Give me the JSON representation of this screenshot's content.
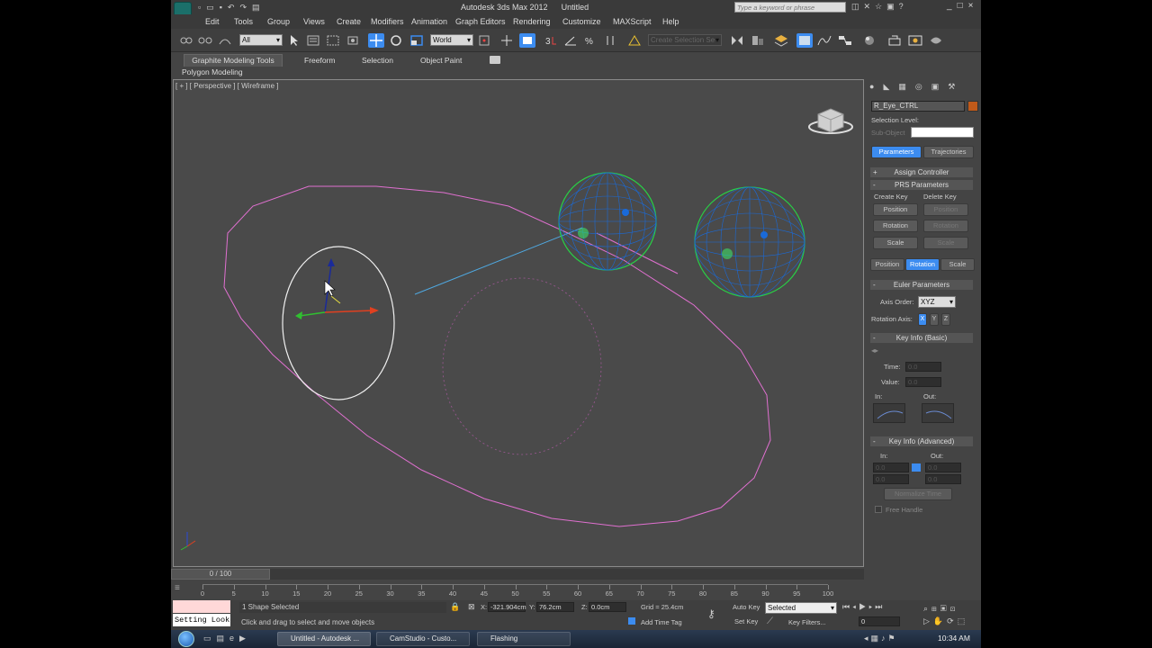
{
  "window": {
    "title_app": "Autodesk 3ds Max 2012",
    "title_file": "Untitled",
    "search_placeholder": "Type a keyword or phrase"
  },
  "menu": [
    "Edit",
    "Tools",
    "Group",
    "Views",
    "Create",
    "Modifiers",
    "Animation",
    "Graph Editors",
    "Rendering",
    "Customize",
    "MAXScript",
    "Help"
  ],
  "toolbar": {
    "selection_filter": "All",
    "ref_coord": "World",
    "named_selection_placeholder": "Create Selection Se"
  },
  "ribbon": {
    "tabs": [
      "Graphite Modeling Tools",
      "Freeform",
      "Selection",
      "Object Paint"
    ],
    "subtab": "Polygon Modeling"
  },
  "viewport": {
    "label": "[ + ] [ Perspective ] [ Wireframe ]"
  },
  "command_panel": {
    "object_name": "R_Eye_CTRL",
    "selection_level_label": "Selection Level:",
    "sub_object_label": "Sub-Object",
    "tabs": [
      "Parameters",
      "Trajectories"
    ],
    "assign_controller": "Assign Controller",
    "prs_header": "PRS Parameters",
    "create_key": "Create Key",
    "delete_key": "Delete Key",
    "create_buttons": [
      "Position",
      "Rotation",
      "Scale"
    ],
    "delete_buttons": [
      "Position",
      "Rotation",
      "Scale"
    ],
    "mode_buttons": [
      "Position",
      "Rotation",
      "Scale"
    ],
    "euler_header": "Euler Parameters",
    "axis_order_label": "Axis Order:",
    "axis_order_value": "XYZ",
    "rotation_axis_label": "Rotation Axis:",
    "rotation_axes": [
      "X",
      "Y",
      "Z"
    ],
    "key_info_basic": "Key Info (Basic)",
    "time_label": "Time:",
    "value_label": "Value:",
    "in_label": "In:",
    "out_label": "Out:",
    "key_info_adv": "Key Info (Advanced)",
    "in_label2": "In:",
    "out_label2": "Out:",
    "normalize_time": "Normalize Time",
    "free_handle": "Free Handle",
    "blank_value": "0.0"
  },
  "timeline": {
    "frame_display": "0 / 100",
    "ticks": [
      "0",
      "5",
      "10",
      "15",
      "20",
      "25",
      "30",
      "35",
      "40",
      "45",
      "50",
      "55",
      "60",
      "65",
      "70",
      "75",
      "80",
      "85",
      "90",
      "95",
      "100"
    ]
  },
  "status": {
    "setting_look": "Setting Look",
    "selected_text": "1 Shape Selected",
    "prompt": "Click and drag to select and move objects",
    "x_value": "-321.904cm",
    "y_value": "76.2cm",
    "z_value": "0.0cm",
    "grid": "Grid = 25.4cm",
    "add_time_tag": "Add Time Tag",
    "auto_key": "Auto Key",
    "set_key": "Set Key",
    "key_mode": "Selected",
    "key_filters": "Key Filters...",
    "frame": "0"
  },
  "taskbar": {
    "items": [
      "Untitled - Autodesk ...",
      "CamStudio - Custo...",
      "Flashing"
    ],
    "clock": "10:34 AM"
  },
  "colors": {
    "accent_blue": "#3c8cf0",
    "spline_pink": "#e070d0",
    "sphere_wire": "#1a6ad8",
    "sphere_outline": "#28d046",
    "eye_circle": "#f0f0f0"
  }
}
